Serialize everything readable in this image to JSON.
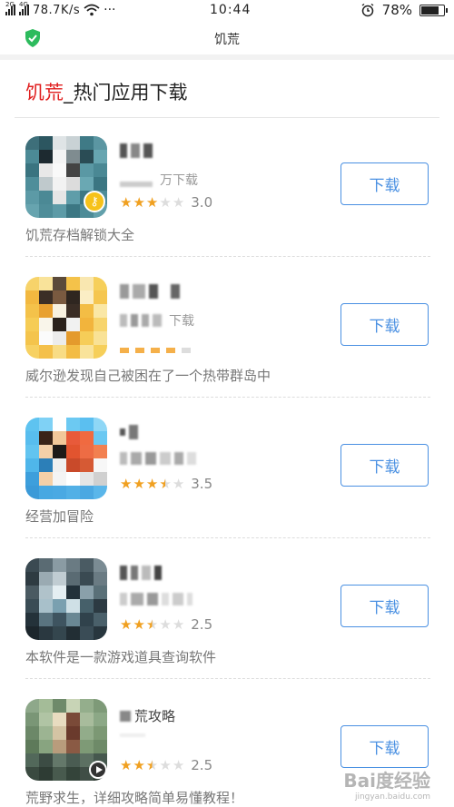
{
  "status_bar": {
    "network_speed": "78.7K/s",
    "more": "···",
    "time": "10:44",
    "battery": "78%",
    "battery_level": 0.78
  },
  "nav": {
    "title": "饥荒"
  },
  "section": {
    "keyword": "饥荒",
    "suffix": "_热门应用下载"
  },
  "apps": [
    {
      "name_visible": "",
      "sub_visible": "万下载",
      "rating": 3.0,
      "rating_text": "3.0",
      "button": "下载",
      "description": "饥荒存档解锁大全",
      "badge": "key-icon"
    },
    {
      "name_visible": "",
      "sub_visible": "下载",
      "rating": null,
      "rating_text": "",
      "button": "下载",
      "description": "威尔逊发现自己被困在了一个热带群岛中",
      "badge": ""
    },
    {
      "name_visible": "",
      "sub_visible": "",
      "rating": 3.5,
      "rating_text": "3.5",
      "button": "下载",
      "description": "经营加冒险",
      "badge": ""
    },
    {
      "name_visible": "",
      "sub_visible": "",
      "rating": 2.5,
      "rating_text": "2.5",
      "button": "下载",
      "description": "本软件是一款游戏道具查询软件",
      "badge": ""
    },
    {
      "name_visible": "荒攻略",
      "sub_visible": "",
      "rating": 2.5,
      "rating_text": "2.5",
      "button": "下载",
      "description": "荒野求生，详细攻略简单易懂教程！",
      "badge": "play-icon"
    }
  ],
  "watermark": {
    "main": "Bai度经验",
    "sub": "jingyan.baidu.com"
  },
  "colors": {
    "accent_blue": "#4a90e2",
    "keyword_red": "#e02020",
    "star": "#f0a020",
    "shield_green": "#2dbb5d"
  }
}
